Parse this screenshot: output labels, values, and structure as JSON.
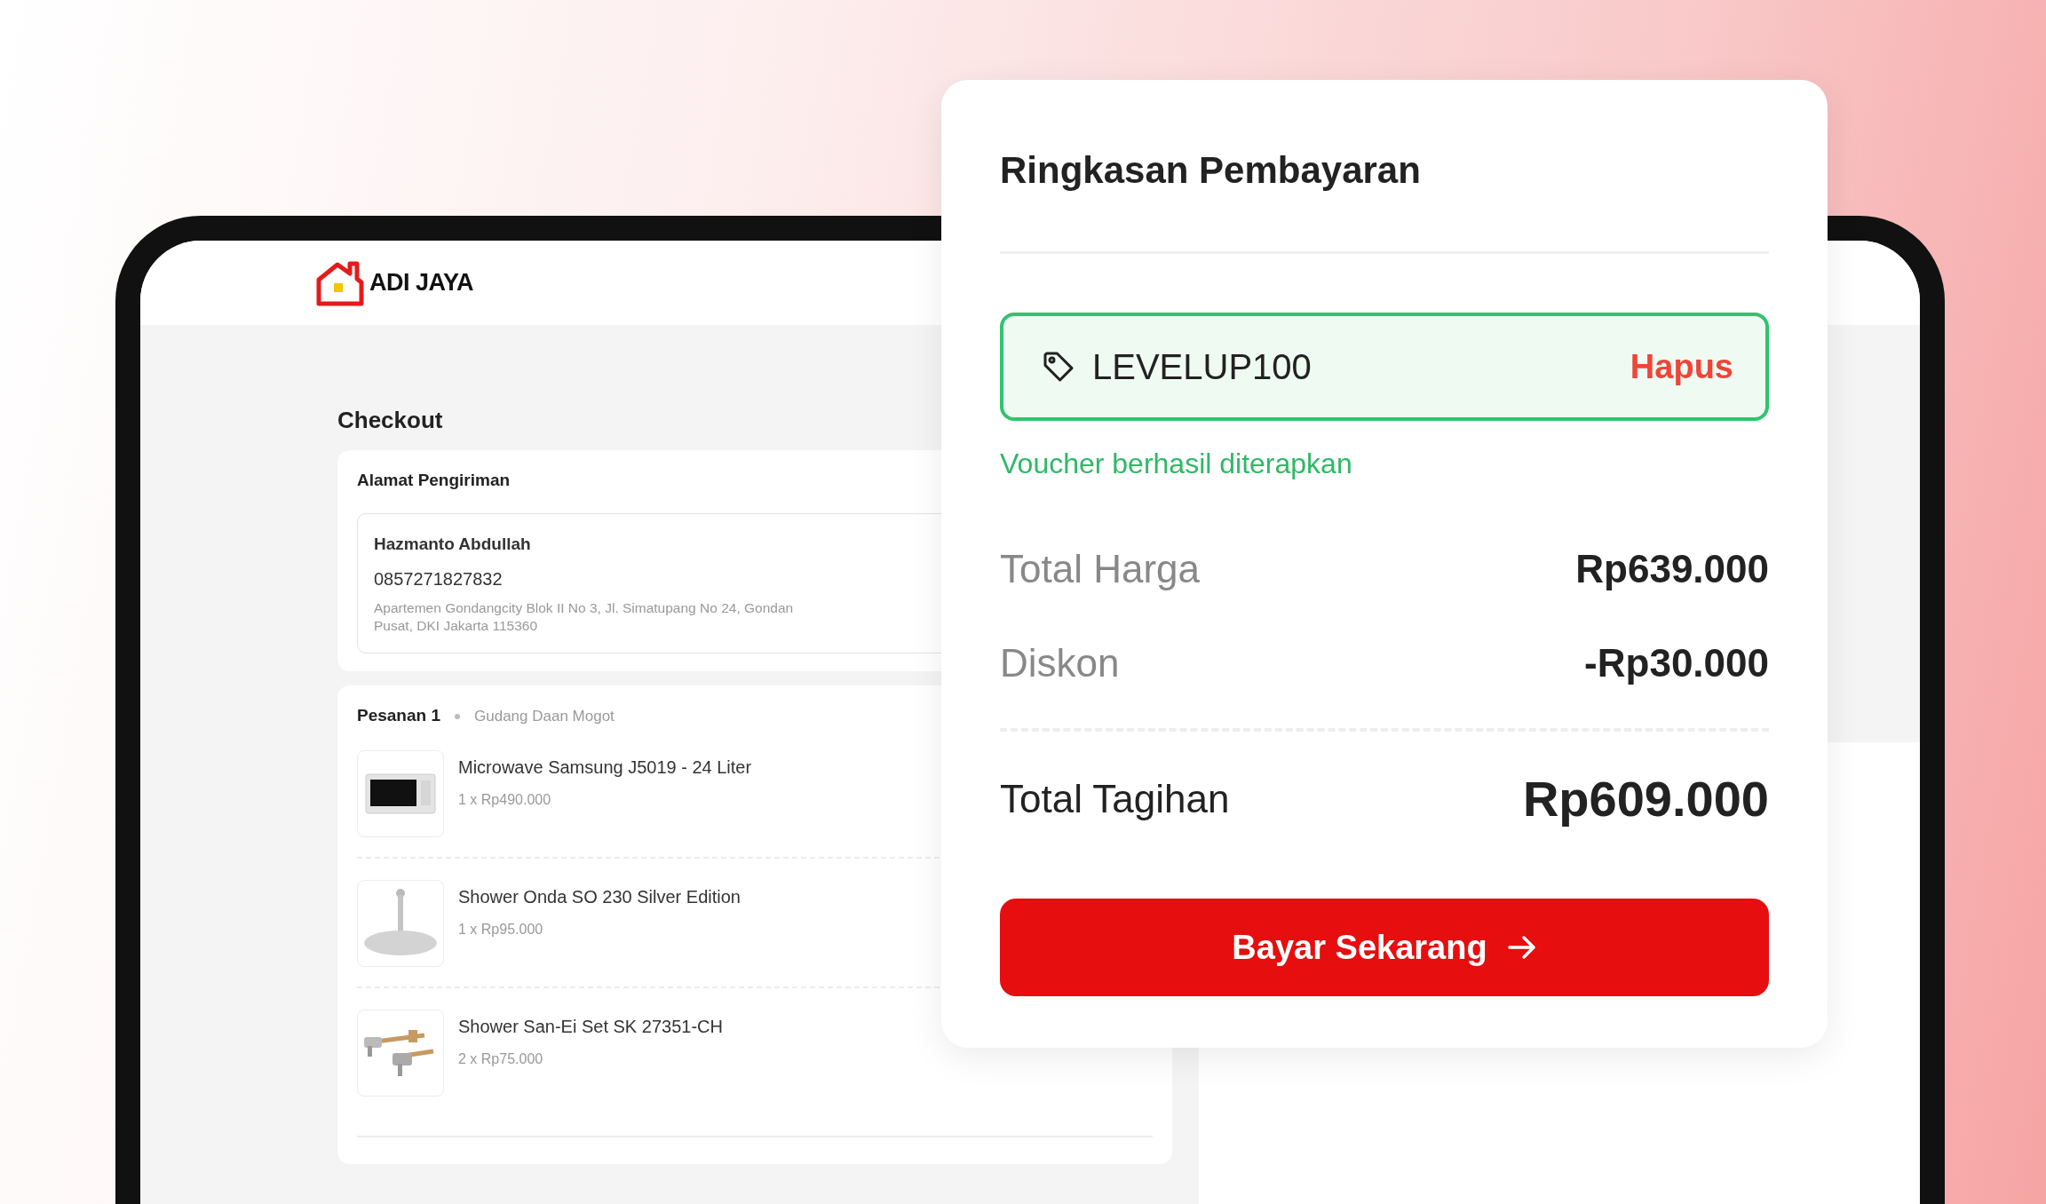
{
  "logo": {
    "name": "ADI JAYA"
  },
  "checkout": {
    "title": "Checkout",
    "address": {
      "heading": "Alamat Pengiriman",
      "recipient": "Hazmanto Abdullah",
      "phone": "0857271827832",
      "lines": [
        "Apartemen Gondangcity Blok II No 3, Jl. Simatupang No 24, Gondan",
        "Pusat, DKI Jakarta 115360"
      ]
    },
    "order": {
      "title": "Pesanan 1",
      "warehouse": "Gudang Daan Mogot",
      "items": [
        {
          "kind": "microwave",
          "name": "Microwave Samsung J5019 - 24 Liter",
          "quantity": "1 x Rp490.000"
        },
        {
          "kind": "shower-head",
          "name": "Shower Onda SO 230 Silver Edition",
          "quantity": "1 x Rp95.000"
        },
        {
          "kind": "shower-set",
          "name": "Shower San-Ei Set SK 27351-CH",
          "quantity": "2 x Rp75.000"
        }
      ]
    }
  },
  "summary": {
    "title": "Ringkasan Pembayaran",
    "voucher": {
      "code": "LEVELUP100",
      "remove": "Hapus",
      "message": "Voucher berhasil diterapkan"
    },
    "rows": [
      {
        "label": "Total Harga",
        "value": "Rp639.000"
      },
      {
        "label": "Diskon",
        "value": "-Rp30.000"
      }
    ],
    "total": {
      "label": "Total Tagihan",
      "value": "Rp609.000"
    },
    "button": {
      "label": "Bayar Sekarang"
    }
  }
}
